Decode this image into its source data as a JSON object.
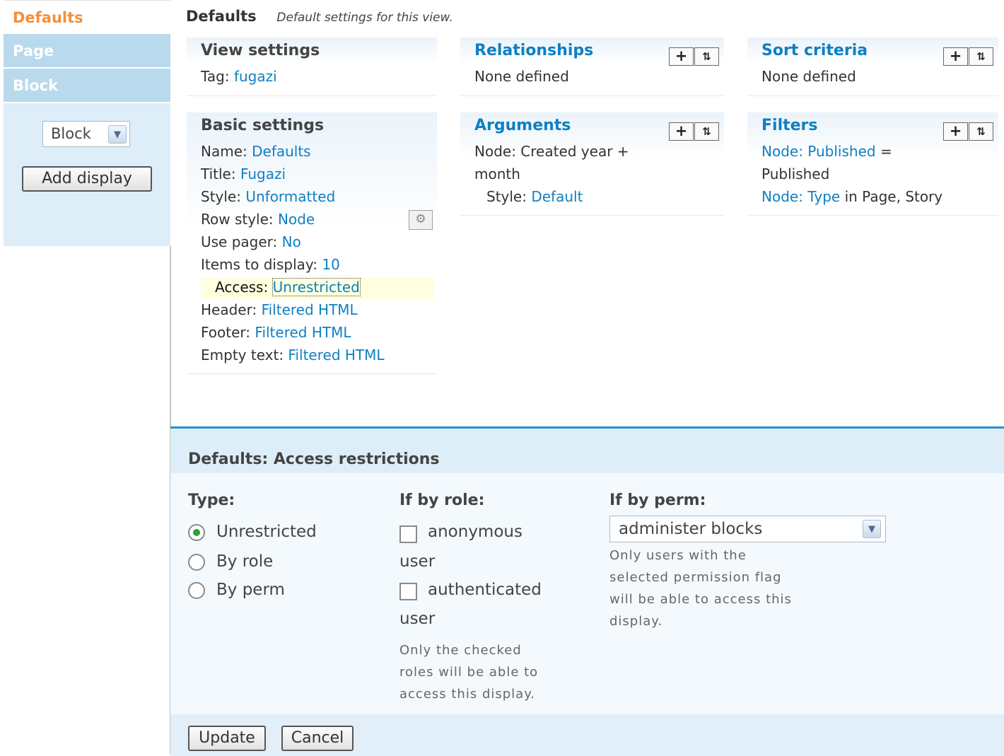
{
  "tabs": [
    "Defaults",
    "Page",
    "Block"
  ],
  "display_select": {
    "value": "Block"
  },
  "add_display_label": "Add display",
  "header": {
    "title": "Defaults",
    "description": "Default settings for this view."
  },
  "view_settings": {
    "title": "View settings",
    "tag_label": "Tag:",
    "tag_value": "fugazi"
  },
  "relationships": {
    "title": "Relationships",
    "text": "None defined"
  },
  "sort_criteria": {
    "title": "Sort criteria",
    "text": "None defined"
  },
  "basic_settings": {
    "title": "Basic settings",
    "rows": [
      {
        "label": "Name:",
        "value": "Defaults"
      },
      {
        "label": "Title:",
        "value": "Fugazi"
      },
      {
        "label": "Style:",
        "value": "Unformatted"
      },
      {
        "label": "Row style:",
        "value": "Node"
      },
      {
        "label": "Use pager:",
        "value": "No"
      },
      {
        "label": "Items to display:",
        "value": "10"
      },
      {
        "label": "Access:",
        "value": "Unrestricted"
      },
      {
        "label": "Header:",
        "value": "Filtered HTML"
      },
      {
        "label": "Footer:",
        "value": "Filtered HTML"
      },
      {
        "label": "Empty text:",
        "value": "Filtered HTML"
      }
    ]
  },
  "arguments": {
    "title": "Arguments",
    "item_line1": "Node: Created year +",
    "item_line2": "month",
    "style_label": "Style:",
    "style_value": "Default"
  },
  "filters": {
    "title": "Filters",
    "f1_link": "Node: Published",
    "f1_rest": " =",
    "f1_line2": "Published",
    "f2_link": "Node: Type",
    "f2_rest": " in Page, Story"
  },
  "access_form": {
    "title": "Defaults: Access restrictions",
    "type_label": "Type:",
    "types": [
      "Unrestricted",
      "By role",
      "By perm"
    ],
    "selected_type": "Unrestricted",
    "role_label": "If by role:",
    "roles": [
      {
        "line1": "anonymous",
        "line2": "user",
        "checked": false
      },
      {
        "line1": "authenticated",
        "line2": "user",
        "checked": false
      }
    ],
    "role_desc": [
      "Only the checked",
      "roles will be able to",
      "access this display."
    ],
    "perm_label": "If by perm:",
    "perm_value": "administer blocks",
    "perm_desc": [
      "Only users with the",
      "selected permission flag",
      "will be able to access this",
      "display."
    ],
    "update_label": "Update",
    "cancel_label": "Cancel"
  },
  "colors": {
    "link": "#0f7fc2",
    "active_tab": "#f5903a",
    "tab_bg": "#b9d9ec",
    "panel_bg": "#ddeef9",
    "accent_border": "#2b8fce"
  }
}
